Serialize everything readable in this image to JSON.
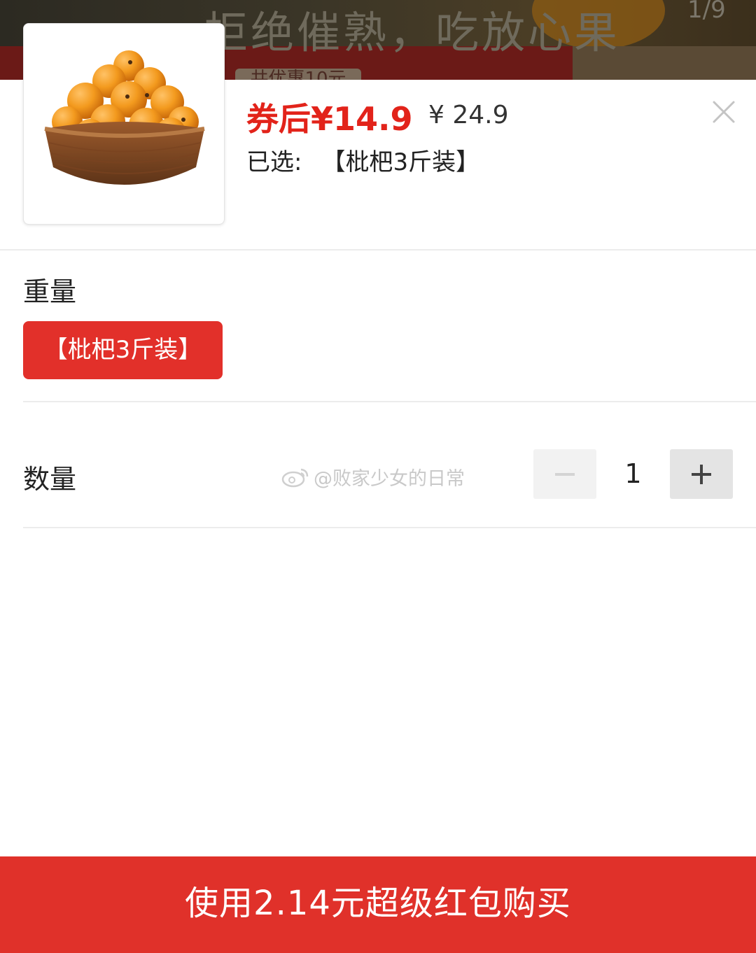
{
  "banner": {
    "title": "拒绝催熟，吃放心果",
    "counter": "1/9",
    "tag": "共优惠10元"
  },
  "product": {
    "image_icon": "loquat-basket-image",
    "coupon_price": "券后¥14.9",
    "original_price": "¥ 24.9",
    "selected_label": "已选:",
    "selected_value": "【枇杷3斤装】"
  },
  "spec": {
    "label": "重量",
    "options": [
      {
        "label": "【枇杷3斤装】",
        "selected": true
      }
    ]
  },
  "quantity": {
    "label": "数量",
    "value": "1"
  },
  "watermark": {
    "text": "@败家少女的日常",
    "icon": "weibo-icon"
  },
  "footer": {
    "buy_label": "使用2.14元超级红包购买"
  },
  "colors": {
    "accent": "#e2231a",
    "button": "#e0312a",
    "divider": "#ececec"
  }
}
